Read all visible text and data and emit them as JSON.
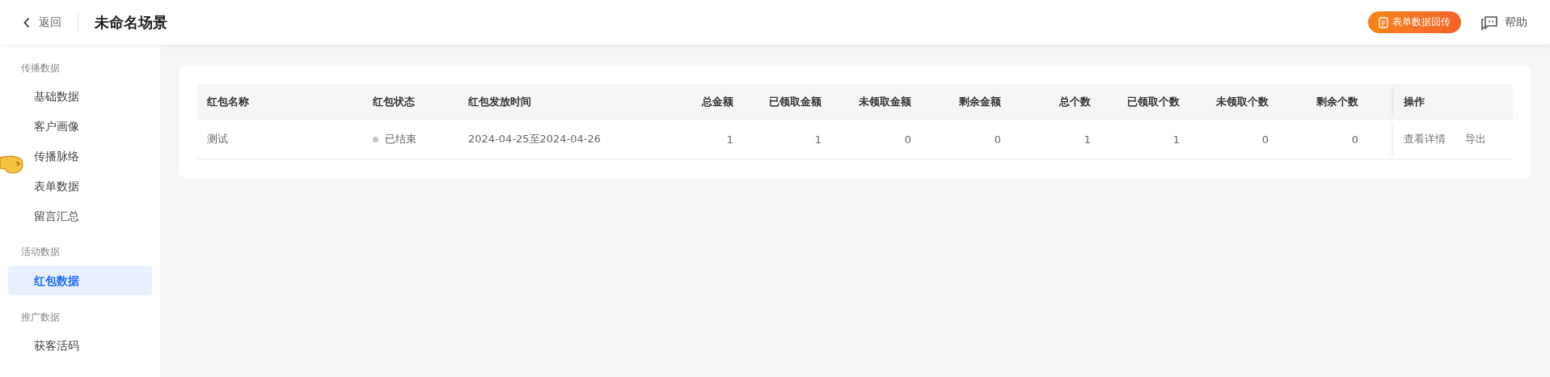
{
  "header": {
    "back": "返回",
    "title": "未命名场景",
    "action_button": "表单数据回传",
    "help": "帮助"
  },
  "sidebar": {
    "groups": [
      {
        "label": "传播数据",
        "items": [
          {
            "label": "基础数据",
            "selected": false
          },
          {
            "label": "客户画像",
            "selected": false
          },
          {
            "label": "传播脉络",
            "selected": false
          },
          {
            "label": "表单数据",
            "selected": false
          },
          {
            "label": "留言汇总",
            "selected": false
          }
        ]
      },
      {
        "label": "活动数据",
        "items": [
          {
            "label": "红包数据",
            "selected": true
          }
        ]
      },
      {
        "label": "推广数据",
        "items": [
          {
            "label": "获客活码",
            "selected": false
          }
        ]
      }
    ]
  },
  "table": {
    "columns": [
      "红包名称",
      "红包状态",
      "红包发放时间",
      "总金额",
      "已领取金额",
      "未领取金额",
      "剩余金额",
      "总个数",
      "已领取个数",
      "未领取个数",
      "剩余个数"
    ],
    "actions_column": "操作",
    "rows": [
      {
        "cells": [
          "测试",
          {
            "status": "已结束",
            "color": "#c0c4cc"
          },
          "2024-04-25至2024-04-26",
          "1",
          "1",
          "0",
          "0",
          "1",
          "1",
          "0",
          "0"
        ],
        "actions": [
          "查看详情",
          "导出"
        ]
      }
    ]
  }
}
